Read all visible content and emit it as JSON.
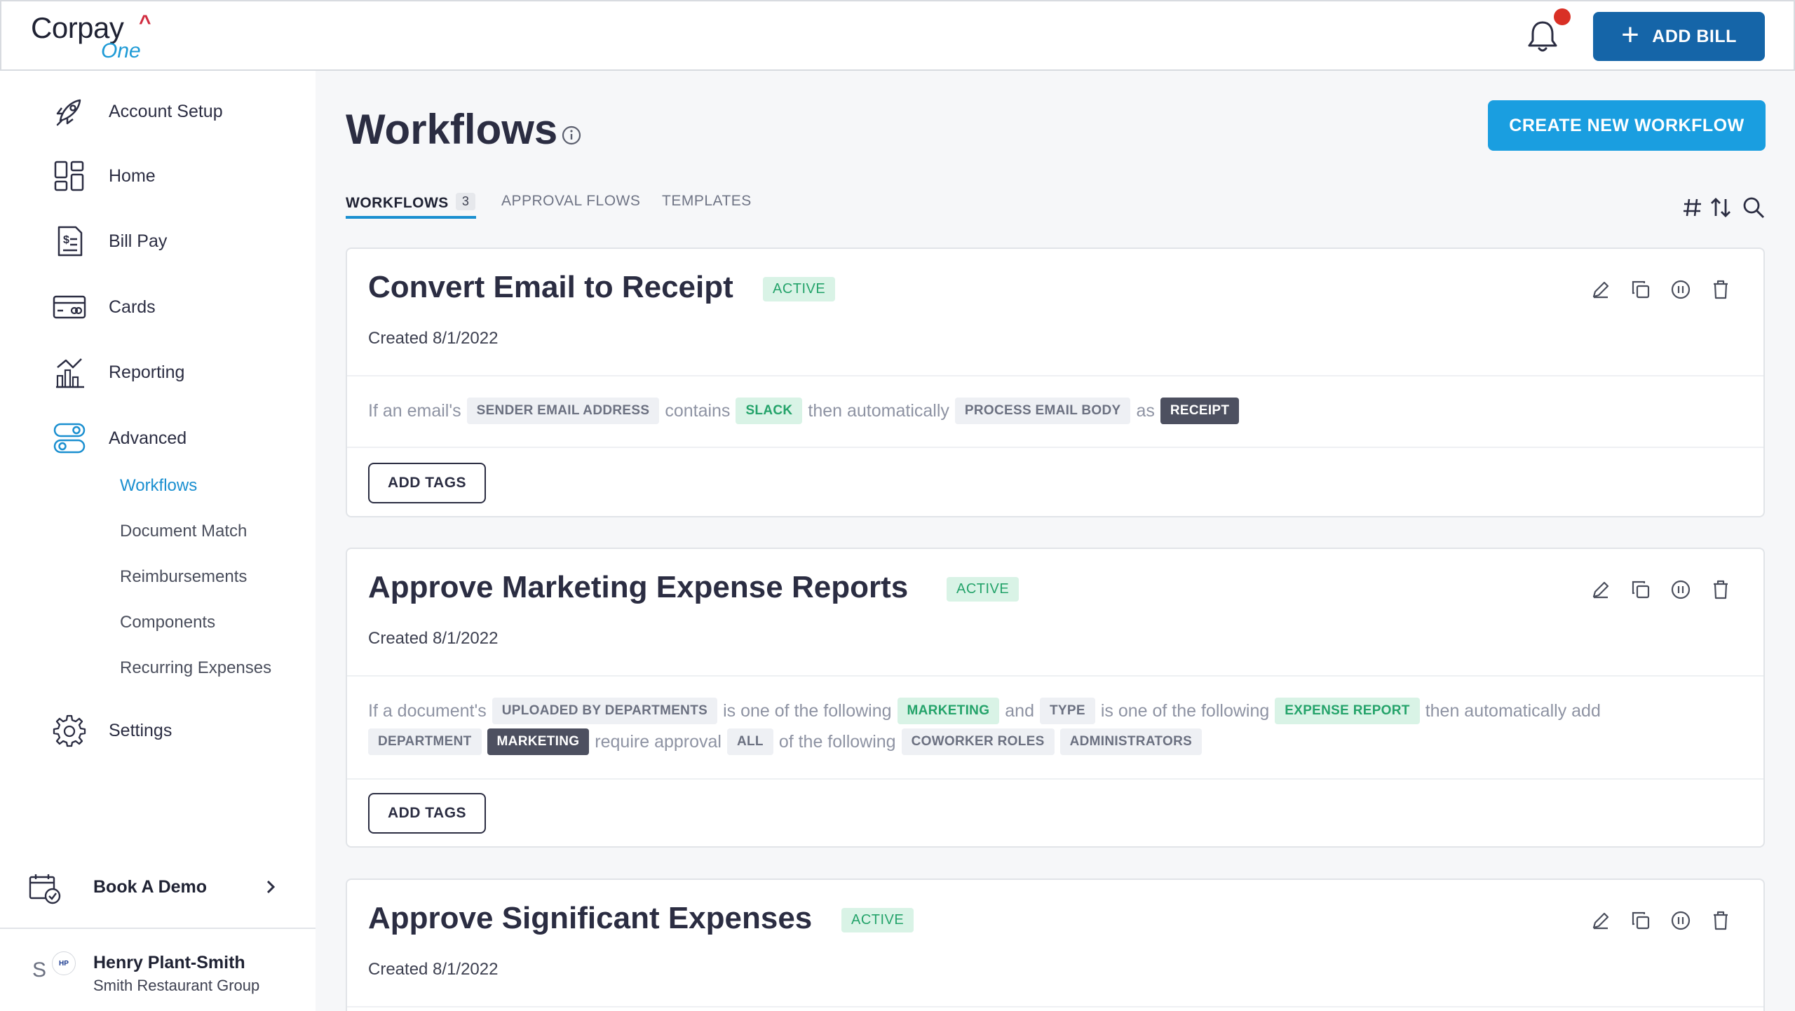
{
  "header": {
    "logo_brand": "Corpay",
    "logo_sub": "One",
    "add_bill_label": "ADD BILL"
  },
  "sidebar": {
    "items": [
      {
        "label": "Account Setup",
        "icon": "rocket-icon"
      },
      {
        "label": "Home",
        "icon": "dashboard-icon"
      },
      {
        "label": "Bill Pay",
        "icon": "bill-icon"
      },
      {
        "label": "Cards",
        "icon": "card-icon"
      },
      {
        "label": "Reporting",
        "icon": "chart-icon"
      },
      {
        "label": "Advanced",
        "icon": "toggles-icon"
      },
      {
        "label": "Settings",
        "icon": "gear-icon"
      }
    ],
    "advanced_sub": [
      "Workflows",
      "Document Match",
      "Reimbursements",
      "Components",
      "Recurring Expenses"
    ],
    "book_demo": "Book A Demo",
    "user": {
      "initial": "S",
      "badge": "HP",
      "name": "Henry Plant-Smith",
      "org": "Smith Restaurant Group"
    }
  },
  "main": {
    "title": "Workflows",
    "create_label": "CREATE NEW WORKFLOW",
    "tabs": [
      {
        "label": "WORKFLOWS",
        "count": "3"
      },
      {
        "label": "APPROVAL FLOWS"
      },
      {
        "label": "TEMPLATES"
      }
    ],
    "cards": [
      {
        "title": "Convert Email to Receipt",
        "status": "ACTIVE",
        "created": "Created 8/1/2022",
        "rule": {
          "t1": "If an email's",
          "c1": "SENDER EMAIL ADDRESS",
          "t2": "contains",
          "c2": "SLACK",
          "t3": "then automatically",
          "c3": "PROCESS EMAIL BODY",
          "t4": "as",
          "c4": "RECEIPT"
        },
        "add_tags": "ADD TAGS"
      },
      {
        "title": "Approve Marketing Expense Reports",
        "status": "ACTIVE",
        "created": "Created 8/1/2022",
        "rule": {
          "t1": "If a document's",
          "c1": "UPLOADED BY DEPARTMENTS",
          "t2": "is one of the following",
          "c2": "MARKETING",
          "t3": "and",
          "c3": "TYPE",
          "t4": "is one of the following",
          "c4": "EXPENSE REPORT",
          "t5": "then automatically add",
          "c5": "DEPARTMENT",
          "c6": "MARKETING",
          "t6": "require approval",
          "c7": "ALL",
          "t7": "of the following",
          "c8": "COWORKER ROLES",
          "c9": "ADMINISTRATORS"
        },
        "add_tags": "ADD TAGS"
      },
      {
        "title": "Approve Significant Expenses",
        "status": "ACTIVE",
        "created": "Created 8/1/2022"
      }
    ]
  },
  "colors": {
    "accent": "#1a9ee0",
    "primary_dark": "#1565a8",
    "active_green": "#24a36a",
    "notification": "#d93025"
  }
}
